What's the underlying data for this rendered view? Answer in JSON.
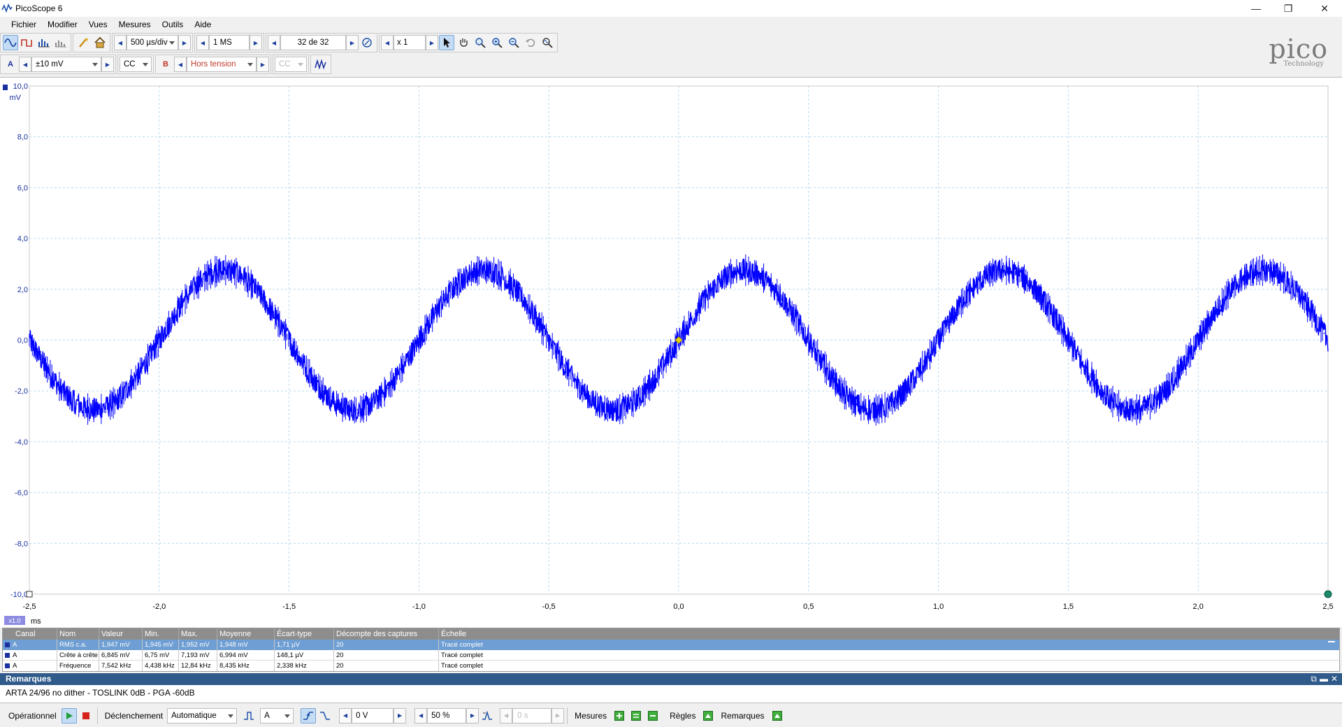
{
  "window": {
    "title": "PicoScope 6"
  },
  "menu": [
    "Fichier",
    "Modifier",
    "Vues",
    "Mesures",
    "Outils",
    "Aide"
  ],
  "toolbar": {
    "timebase": "500 µs/div",
    "samples": "1 MS",
    "buffer": "32 de 32",
    "zoom": "x 1"
  },
  "logo": {
    "brand": "pico",
    "sub": "Technology"
  },
  "channel_a": {
    "label": "A",
    "range": "±10 mV",
    "coupling": "CC"
  },
  "channel_b": {
    "label": "B",
    "range": "Hors tension",
    "coupling": "CC"
  },
  "scope": {
    "y_unit": "mV",
    "x_unit": "ms",
    "x_zoom_badge": "x1.0",
    "y_ticks": [
      "10,0",
      "8,0",
      "6,0",
      "4,0",
      "2,0",
      "0,0",
      "-2,0",
      "-4,0",
      "-6,0",
      "-8,0",
      "-10,0"
    ],
    "x_ticks": [
      "-2,5",
      "-2,0",
      "-1,5",
      "-1,0",
      "-0,5",
      "0,0",
      "0,5",
      "1,0",
      "1,5",
      "2,0",
      "2,5"
    ],
    "trace_color": "#0000ff",
    "trigger_color": "#e6d200"
  },
  "chart_data": {
    "type": "line",
    "x_range": [
      -2.5,
      2.5
    ],
    "y_range": [
      -10,
      10
    ],
    "series": [
      {
        "amplitude_mV": 2.75,
        "frequency_kHz": 1.0,
        "noise_pp_mV": 0.9,
        "phase_at_zero": 0.0
      }
    ],
    "grid": true
  },
  "measurements": {
    "headers": [
      "Canal",
      "Nom",
      "Valeur",
      "Min.",
      "Max.",
      "Moyenne",
      "Écart-type",
      "Décompte des captures",
      "Échelle"
    ],
    "rows": [
      [
        "A",
        "RMS c.a.",
        "1,947 mV",
        "1,945 mV",
        "1,952 mV",
        "1,948 mV",
        "1,71 µV",
        "20",
        "Tracé complet"
      ],
      [
        "A",
        "Crête à crête",
        "6,845 mV",
        "6,75 mV",
        "7,193 mV",
        "6,994 mV",
        "148,1 µV",
        "20",
        "Tracé complet"
      ],
      [
        "A",
        "Fréquence",
        "7,542 kHz",
        "4,438 kHz",
        "12,84 kHz",
        "8,435 kHz",
        "2,338 kHz",
        "20",
        "Tracé complet"
      ]
    ]
  },
  "remarks": {
    "title": "Remarques",
    "text": "ARTA 24/96 no dither - TOSLINK 0dB - PGA -60dB"
  },
  "bottom": {
    "status": "Opérationnel",
    "trigger_label": "Déclenchement",
    "trigger_mode": "Automatique",
    "trigger_channel": "A",
    "trigger_level": "0 V",
    "pretrigger": "50 %",
    "delay": "0 s",
    "mesures_label": "Mesures",
    "regles_label": "Règles",
    "remarques_label": "Remarques"
  }
}
